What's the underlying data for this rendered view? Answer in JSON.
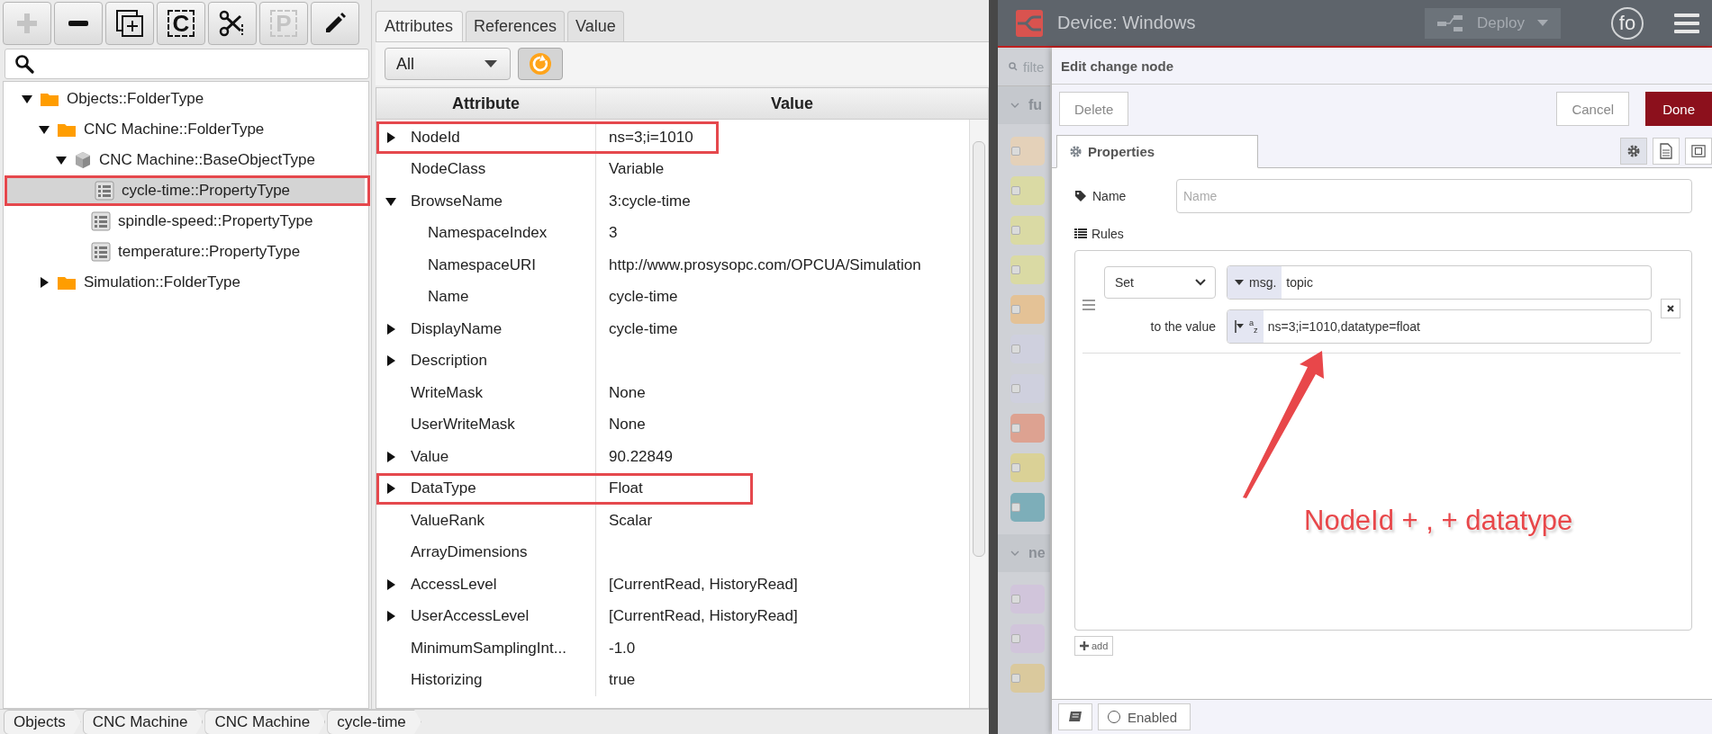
{
  "toolbar": {
    "buttons": [
      {
        "kind": "add",
        "disabled": true
      },
      {
        "kind": "remove",
        "disabled": false
      },
      {
        "kind": "new",
        "disabled": false
      },
      {
        "kind": "copy",
        "glyph": "C",
        "disabled": false
      },
      {
        "kind": "cut",
        "disabled": false
      },
      {
        "kind": "paste",
        "glyph": "P",
        "disabled": true
      },
      {
        "kind": "edit",
        "disabled": false
      }
    ]
  },
  "tree": {
    "items": [
      {
        "label": "Objects::FolderType",
        "kind": "folder",
        "expanded": true,
        "selected": false,
        "highlighted": false,
        "children": [
          {
            "label": "CNC Machine::FolderType",
            "kind": "folder",
            "expanded": true,
            "selected": false,
            "highlighted": false,
            "children": [
              {
                "label": "CNC Machine::BaseObjectType",
                "kind": "object",
                "expanded": true,
                "selected": false,
                "highlighted": false,
                "children": [
                  {
                    "label": "cycle-time::PropertyType",
                    "kind": "property",
                    "selected": true,
                    "highlighted": true
                  },
                  {
                    "label": "spindle-speed::PropertyType",
                    "kind": "property",
                    "selected": false,
                    "highlighted": false
                  },
                  {
                    "label": "temperature::PropertyType",
                    "kind": "property",
                    "selected": false,
                    "highlighted": false
                  }
                ]
              }
            ]
          },
          {
            "label": "Simulation::FolderType",
            "kind": "folder",
            "expanded": false,
            "selected": false,
            "highlighted": false
          }
        ]
      }
    ]
  },
  "attributes_panel": {
    "tabs": [
      {
        "label": "Attributes",
        "selected": true
      },
      {
        "label": "References",
        "selected": false
      },
      {
        "label": "Value",
        "selected": false
      }
    ],
    "filter": {
      "value": "All"
    },
    "table": {
      "columns": [
        "Attribute",
        "Value"
      ],
      "rows": [
        {
          "attribute": "NodeId",
          "value": "ns=3;i=1010",
          "kind": "branch",
          "expanded": false,
          "highlighted": true
        },
        {
          "attribute": "NodeClass",
          "value": "Variable",
          "kind": "leaf",
          "highlighted": false
        },
        {
          "attribute": "BrowseName",
          "value": "3:cycle-time",
          "kind": "branch",
          "expanded": true,
          "highlighted": false,
          "children": [
            {
              "attribute": "NamespaceIndex",
              "value": "3",
              "kind": "leaf",
              "highlighted": false
            },
            {
              "attribute": "NamespaceURI",
              "value": "http://www.prosysopc.com/OPCUA/Simulation",
              "kind": "leaf",
              "highlighted": false
            },
            {
              "attribute": "Name",
              "value": "cycle-time",
              "kind": "leaf",
              "highlighted": false
            }
          ]
        },
        {
          "attribute": "DisplayName",
          "value": "cycle-time",
          "kind": "branch",
          "expanded": false,
          "highlighted": false
        },
        {
          "attribute": "Description",
          "kind": "branch",
          "expanded": false,
          "highlighted": false
        },
        {
          "attribute": "WriteMask",
          "value": "None",
          "kind": "leaf",
          "highlighted": false
        },
        {
          "attribute": "UserWriteMask",
          "value": "None",
          "kind": "leaf",
          "highlighted": false
        },
        {
          "attribute": "Value",
          "value": "90.22849",
          "kind": "branch",
          "expanded": false,
          "highlighted": false
        },
        {
          "attribute": "DataType",
          "value": "Float",
          "kind": "branch",
          "expanded": false,
          "highlighted": true
        },
        {
          "attribute": "ValueRank",
          "value": "Scalar",
          "kind": "leaf",
          "highlighted": false
        },
        {
          "attribute": "ArrayDimensions",
          "kind": "leaf",
          "highlighted": false
        },
        {
          "attribute": "AccessLevel",
          "value": "[CurrentRead, HistoryRead]",
          "kind": "branch",
          "expanded": false,
          "highlighted": false
        },
        {
          "attribute": "UserAccessLevel",
          "value": "[CurrentRead, HistoryRead]",
          "kind": "branch",
          "expanded": false,
          "highlighted": false
        },
        {
          "attribute": "MinimumSamplingInt...",
          "value": "-1.0",
          "kind": "leaf",
          "highlighted": false
        },
        {
          "attribute": "Historizing",
          "value": "true",
          "kind": "leaf",
          "highlighted": false
        }
      ]
    }
  },
  "breadcrumbs": [
    "Objects",
    "CNC Machine",
    "CNC Machine",
    "cycle-time"
  ],
  "node_red": {
    "header": {
      "title": "Device: Windows",
      "deploy": {
        "label": "Deploy",
        "disabled": true
      },
      "user": "fo"
    },
    "palette": {
      "filter_placeholder": "filte",
      "categories": [
        {
          "label": "fu",
          "nodes": [
            {
              "color": "#e8d2b4"
            },
            {
              "color": "#dcdc9c"
            },
            {
              "color": "#dcdc9c"
            },
            {
              "color": "#dcdc9c"
            },
            {
              "color": "#e8c08c"
            },
            {
              "color": "#cfd0e0"
            },
            {
              "color": "#cfd0e0"
            },
            {
              "color": "#e09a86"
            },
            {
              "color": "#dcd28c"
            },
            {
              "color": "#6fa8b4"
            }
          ]
        },
        {
          "label": "ne",
          "nodes": [
            {
              "color": "#d2c4dc"
            },
            {
              "color": "#d2c4dc"
            },
            {
              "color": "#dcc894"
            }
          ]
        }
      ]
    },
    "tray": {
      "title": "Edit change node",
      "buttons": [
        {
          "label": "Delete",
          "kind": "secondary"
        },
        {
          "label": "Cancel",
          "kind": "secondary"
        },
        {
          "label": "Done",
          "kind": "primary"
        }
      ],
      "tabs": [
        {
          "label": "Properties",
          "selected": true
        }
      ],
      "name_field": {
        "label": "Name",
        "placeholder": "Name"
      },
      "rules_label": "Rules",
      "rules": [
        {
          "action": "Set",
          "target_prefix": "msg.",
          "target": "topic",
          "value_label": "to the value",
          "value_type": "$^{a}$$_{z}$",
          "value": "ns=3;i=1010,datatype=float"
        }
      ],
      "add_label": "add",
      "footer": {
        "enabled_label": "Enabled",
        "enabled": false
      }
    }
  },
  "annotation": {
    "text": "NodeId + , + datatype"
  }
}
